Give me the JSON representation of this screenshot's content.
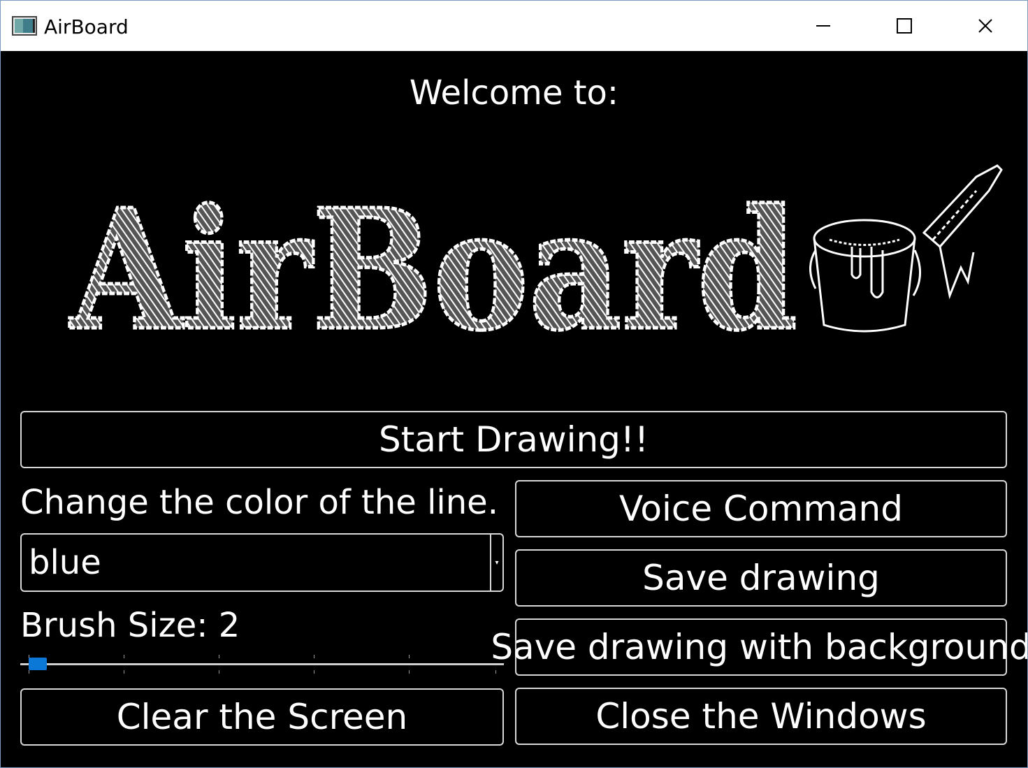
{
  "window": {
    "title": "AirBoard",
    "minimize_glyph": "—",
    "maximize_glyph": "☐",
    "close_glyph": "✕"
  },
  "main": {
    "welcome": "Welcome to:",
    "logo_text": "AirBoard",
    "start_button": "Start Drawing!!",
    "color_label": "Change the color of the line.",
    "color_select_value": "blue",
    "brush_label": "Brush Size: 2",
    "brush_size": 2,
    "voice_button": "Voice Command",
    "save_button": "Save drawing",
    "save_bg_button": "Save drawing with background",
    "clear_button": "Clear the Screen",
    "close_button": "Close the Windows"
  },
  "colors": {
    "background": "#000000",
    "text": "#ffffff",
    "slider_accent": "#0b78d7",
    "border": "#d8d8d8"
  }
}
